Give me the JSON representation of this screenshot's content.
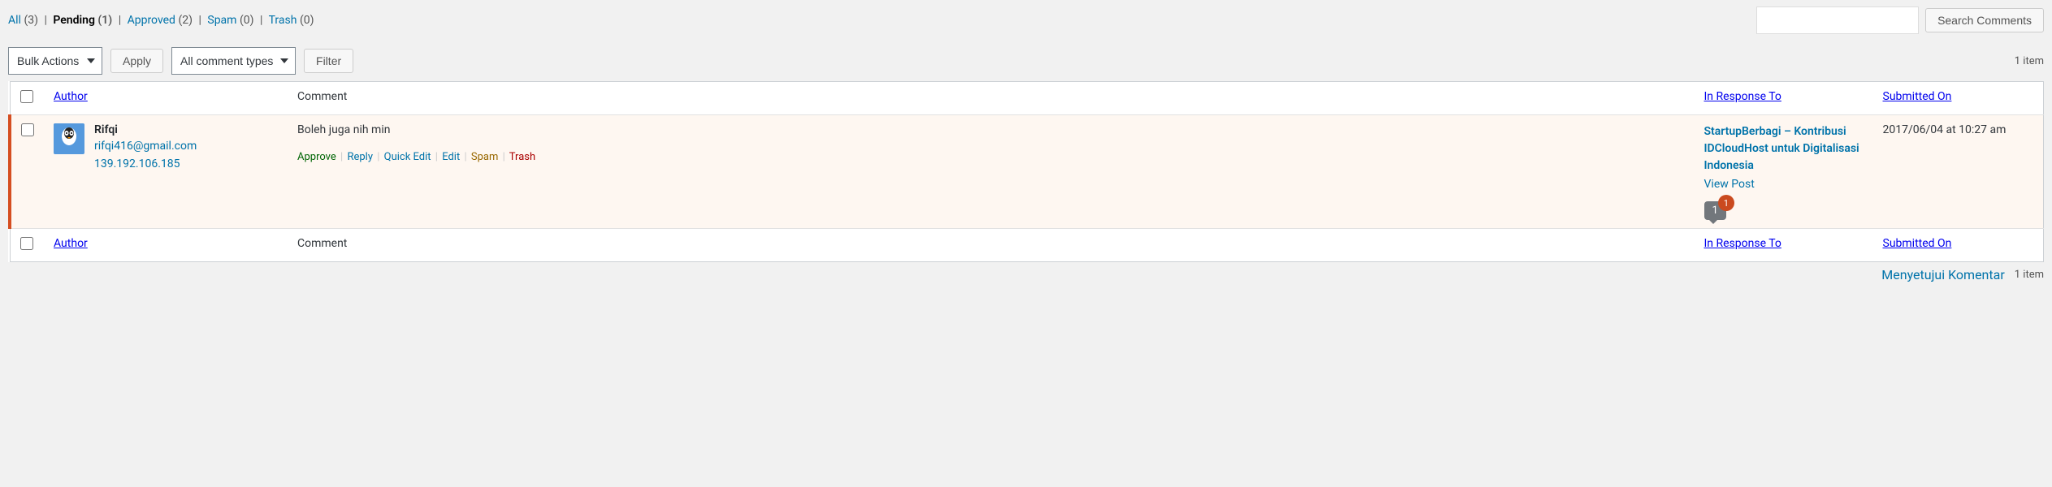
{
  "filters": {
    "all": {
      "label": "All",
      "count": "(3)"
    },
    "pending": {
      "label": "Pending",
      "count": "(1)"
    },
    "approved": {
      "label": "Approved",
      "count": "(2)"
    },
    "spam": {
      "label": "Spam",
      "count": "(0)"
    },
    "trash": {
      "label": "Trash",
      "count": "(0)"
    }
  },
  "search": {
    "button": "Search Comments",
    "value": ""
  },
  "bulk": {
    "selected": "Bulk Actions",
    "apply": "Apply"
  },
  "types": {
    "selected": "All comment types",
    "filter": "Filter"
  },
  "item_count_top": "1 item",
  "item_count_bottom": "1 item",
  "columns": {
    "author": "Author",
    "comment": "Comment",
    "response": "In Response To",
    "date": "Submitted On"
  },
  "comment": {
    "author_name": "Rifqi",
    "author_email": "rifqi416@gmail.com",
    "author_ip": "139.192.106.185",
    "text": "Boleh juga nih min",
    "actions": {
      "approve": "Approve",
      "reply": "Reply",
      "quickedit": "Quick Edit",
      "edit": "Edit",
      "spam": "Spam",
      "trash": "Trash"
    },
    "post_title": "StartupBerbagi – Kontribusi IDCloudHost untuk Digitalisasi Indonesia",
    "view_post": "View Post",
    "bubble_count": "1",
    "pending_badge": "1",
    "date": "2017/06/04 at 10:27 am"
  },
  "caption": "Menyetujui Komentar"
}
